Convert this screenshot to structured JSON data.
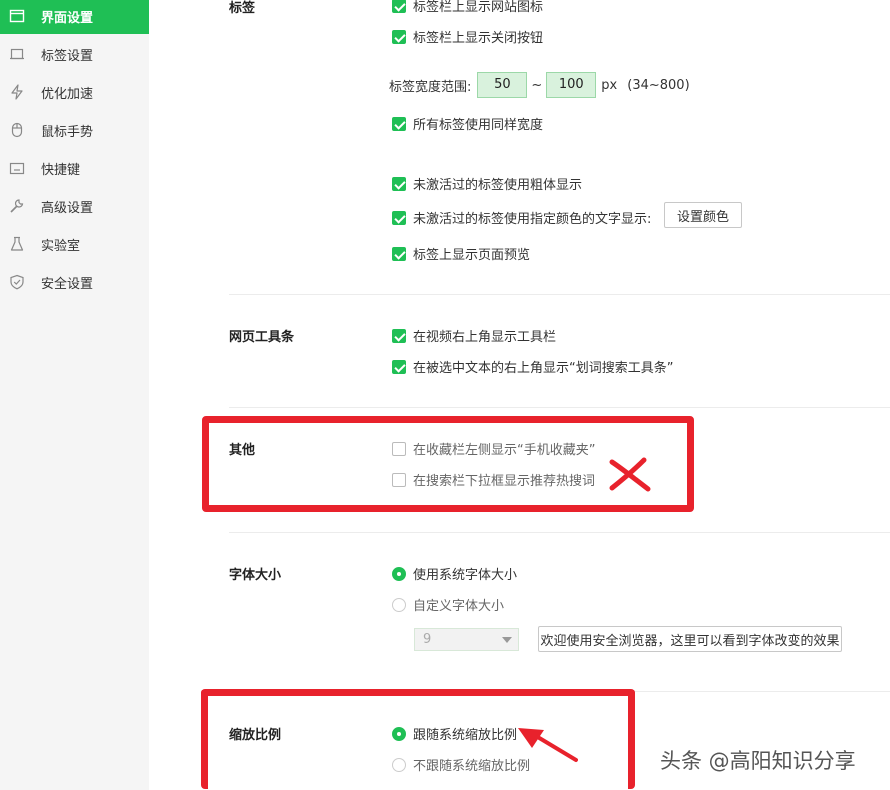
{
  "sidebar": {
    "items": [
      {
        "label": "界面设置",
        "icon": "window-icon",
        "active": true
      },
      {
        "label": "标签设置",
        "icon": "tab-icon",
        "active": false
      },
      {
        "label": "优化加速",
        "icon": "lightning-icon",
        "active": false
      },
      {
        "label": "鼠标手势",
        "icon": "mouse-icon",
        "active": false
      },
      {
        "label": "快捷键",
        "icon": "keyboard-icon",
        "active": false
      },
      {
        "label": "高级设置",
        "icon": "wrench-icon",
        "active": false
      },
      {
        "label": "实验室",
        "icon": "flask-icon",
        "active": false
      },
      {
        "label": "安全设置",
        "icon": "shield-icon",
        "active": false
      }
    ]
  },
  "tabs_section": {
    "title": "标签",
    "opt_favicon": "标签栏上显示网站图标",
    "opt_close_btn": "标签栏上显示关闭按钮",
    "width_label": "标签宽度范围:",
    "width_min": "50",
    "width_tilde": "~",
    "width_max": "100",
    "width_unit": "px",
    "width_range": "(34~800)",
    "opt_same_width": "所有标签使用同样宽度",
    "opt_bold_inactive": "未激活过的标签使用粗体显示",
    "opt_color_inactive": "未激活过的标签使用指定颜色的文字显示:",
    "set_color_button": "设置颜色",
    "opt_preview": "标签上显示页面预览"
  },
  "toolbar_section": {
    "title": "网页工具条",
    "opt_video_toolbar": "在视频右上角显示工具栏",
    "opt_search_toolbar": "在被选中文本的右上角显示“划词搜索工具条”"
  },
  "other_section": {
    "title": "其他",
    "opt_mobile_fav": "在收藏栏左侧显示“手机收藏夹”",
    "opt_hot_search": "在搜索栏下拉框显示推荐热搜词"
  },
  "font_section": {
    "title": "字体大小",
    "opt_system_font": "使用系统字体大小",
    "opt_custom_font": "自定义字体大小",
    "font_size_value": "9",
    "preview_text": "欢迎使用安全浏览器，这里可以看到字体改变的效果"
  },
  "zoom_section": {
    "title": "缩放比例",
    "opt_follow_system": "跟随系统缩放比例",
    "opt_not_follow": "不跟随系统缩放比例"
  },
  "watermark": "头条 @高阳知识分享",
  "colors": {
    "accent": "#1fbf55",
    "annotation_red": "#e8222c"
  }
}
